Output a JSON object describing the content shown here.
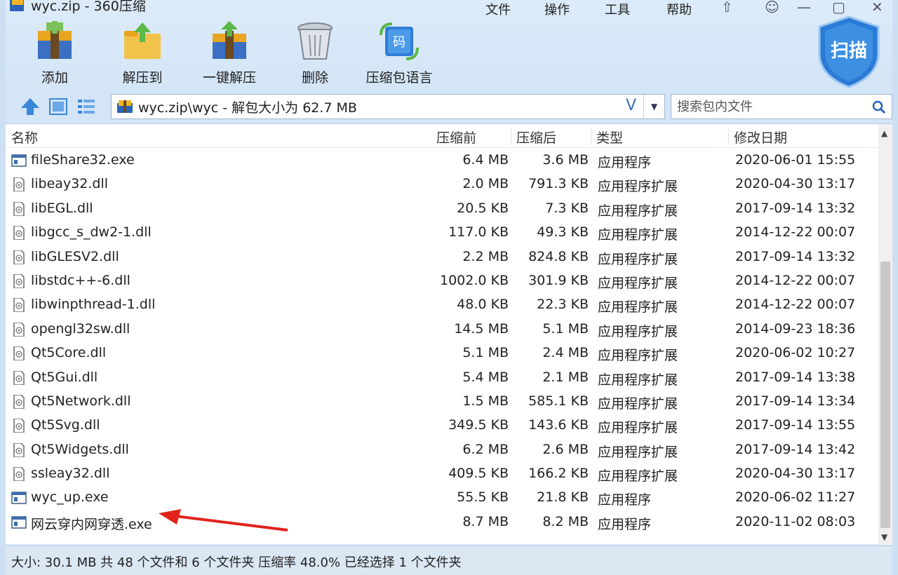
{
  "window": {
    "title": "wyc.zip - 360压缩",
    "menu": [
      "文件",
      "操作",
      "工具",
      "帮助"
    ]
  },
  "toolbar": {
    "items": [
      {
        "label": "添加",
        "icon": "add-archive-icon"
      },
      {
        "label": "解压到",
        "icon": "extract-to-folder-icon"
      },
      {
        "label": "一键解压",
        "icon": "one-click-extract-icon"
      },
      {
        "label": "删除",
        "icon": "trash-bin-icon"
      },
      {
        "label": "压缩包语言",
        "icon": "archive-language-icon"
      }
    ],
    "scan_label": "扫描"
  },
  "address": {
    "path": "wyc.zip\\wyc - 解包大小为 62.7 MB",
    "dropdown_value": "V"
  },
  "search": {
    "placeholder": "搜索包内文件"
  },
  "columns": {
    "name": "名称",
    "size": "压缩前",
    "compressed": "压缩后",
    "type": "类型",
    "modified": "修改日期"
  },
  "files": [
    {
      "name": "fileShare32.exe",
      "size": "6.4 MB",
      "compressed": "3.6 MB",
      "type": "应用程序",
      "modified": "2020-06-01 15:55",
      "kind": "exe"
    },
    {
      "name": "libeay32.dll",
      "size": "2.0 MB",
      "compressed": "791.3 KB",
      "type": "应用程序扩展",
      "modified": "2020-04-30 13:17",
      "kind": "dll"
    },
    {
      "name": "libEGL.dll",
      "size": "20.5 KB",
      "compressed": "7.3 KB",
      "type": "应用程序扩展",
      "modified": "2017-09-14 13:32",
      "kind": "dll"
    },
    {
      "name": "libgcc_s_dw2-1.dll",
      "size": "117.0 KB",
      "compressed": "49.3 KB",
      "type": "应用程序扩展",
      "modified": "2014-12-22 00:07",
      "kind": "dll"
    },
    {
      "name": "libGLESV2.dll",
      "size": "2.2 MB",
      "compressed": "824.8 KB",
      "type": "应用程序扩展",
      "modified": "2017-09-14 13:32",
      "kind": "dll"
    },
    {
      "name": "libstdc++-6.dll",
      "size": "1002.0 KB",
      "compressed": "301.9 KB",
      "type": "应用程序扩展",
      "modified": "2014-12-22 00:07",
      "kind": "dll"
    },
    {
      "name": "libwinpthread-1.dll",
      "size": "48.0 KB",
      "compressed": "22.3 KB",
      "type": "应用程序扩展",
      "modified": "2014-12-22 00:07",
      "kind": "dll"
    },
    {
      "name": "opengl32sw.dll",
      "size": "14.5 MB",
      "compressed": "5.1 MB",
      "type": "应用程序扩展",
      "modified": "2014-09-23 18:36",
      "kind": "dll"
    },
    {
      "name": "Qt5Core.dll",
      "size": "5.1 MB",
      "compressed": "2.4 MB",
      "type": "应用程序扩展",
      "modified": "2020-06-02 10:27",
      "kind": "dll"
    },
    {
      "name": "Qt5Gui.dll",
      "size": "5.4 MB",
      "compressed": "2.1 MB",
      "type": "应用程序扩展",
      "modified": "2017-09-14 13:38",
      "kind": "dll"
    },
    {
      "name": "Qt5Network.dll",
      "size": "1.5 MB",
      "compressed": "585.1 KB",
      "type": "应用程序扩展",
      "modified": "2017-09-14 13:34",
      "kind": "dll"
    },
    {
      "name": "Qt5Svg.dll",
      "size": "349.5 KB",
      "compressed": "143.6 KB",
      "type": "应用程序扩展",
      "modified": "2017-09-14 13:55",
      "kind": "dll"
    },
    {
      "name": "Qt5Widgets.dll",
      "size": "6.2 MB",
      "compressed": "2.6 MB",
      "type": "应用程序扩展",
      "modified": "2017-09-14 13:42",
      "kind": "dll"
    },
    {
      "name": "ssleay32.dll",
      "size": "409.5 KB",
      "compressed": "166.2 KB",
      "type": "应用程序扩展",
      "modified": "2020-04-30 13:17",
      "kind": "dll"
    },
    {
      "name": "wyc_up.exe",
      "size": "55.5 KB",
      "compressed": "21.8 KB",
      "type": "应用程序",
      "modified": "2020-06-02 11:27",
      "kind": "exe"
    },
    {
      "name": "网云穿内网穿透.exe",
      "size": "8.7 MB",
      "compressed": "8.2 MB",
      "type": "应用程序",
      "modified": "2020-11-02 08:03",
      "kind": "exe"
    }
  ],
  "status": {
    "text": "大小: 30.1 MB 共 48 个文件和 6 个文件夹 压缩率 48.0% 已经选择 1 个文件夹"
  },
  "colors": {
    "accent": "#2a63b8",
    "annotation_arrow": "#e0241b",
    "window_bg": "#d3e5f6"
  }
}
